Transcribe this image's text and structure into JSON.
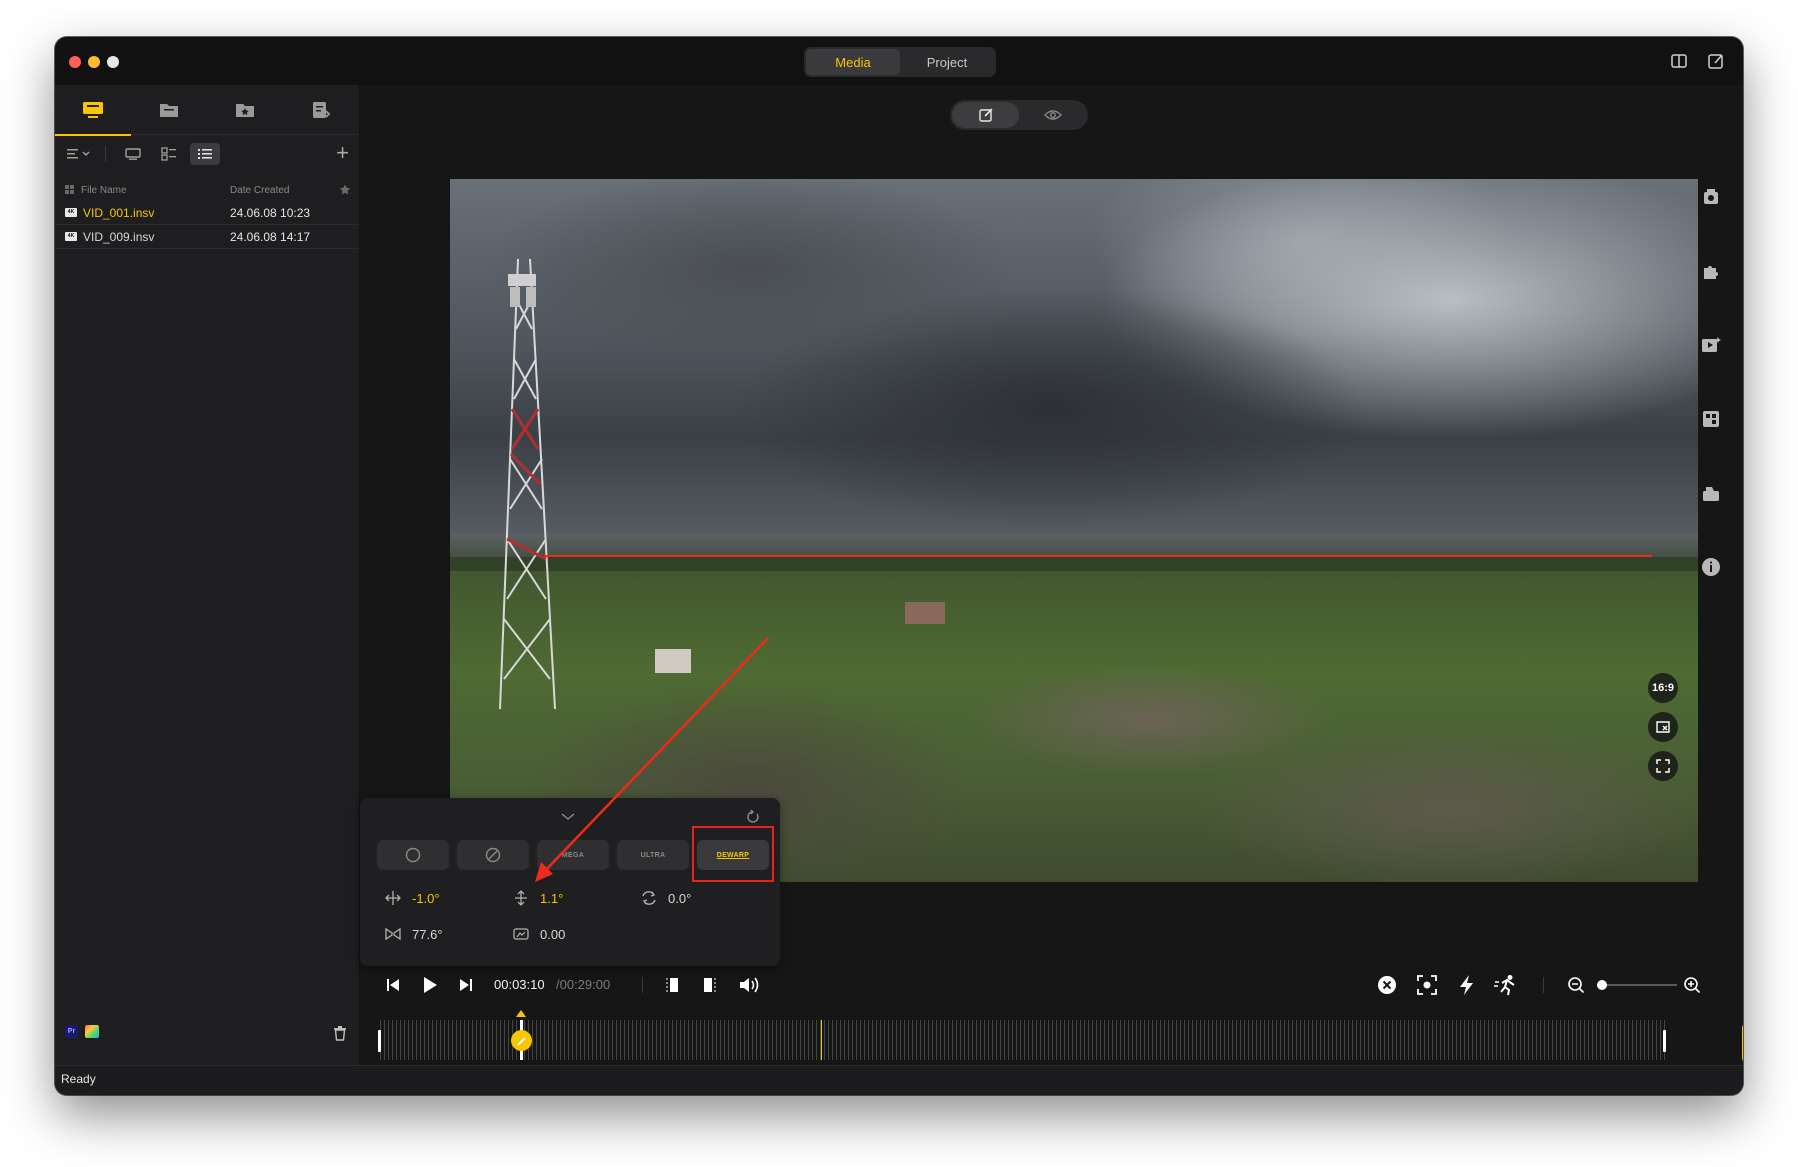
{
  "titlebar": {
    "tabs": [
      {
        "label": "Media",
        "active": true
      },
      {
        "label": "Project",
        "active": false
      }
    ]
  },
  "sidebar": {
    "tabs": [
      "monitor-icon",
      "folder-icon",
      "star-folder-icon",
      "export-list-icon"
    ],
    "file_list": {
      "headers": {
        "name": "File Name",
        "date": "Date Created"
      },
      "rows": [
        {
          "badge": "4K",
          "name": "VID_001.insv",
          "date": "24.06.08 10:23",
          "selected": true
        },
        {
          "badge": "4K",
          "name": "VID_009.insv",
          "date": "24.06.08 14:17",
          "selected": false
        }
      ]
    }
  },
  "viewer": {
    "aspect_ratio": "16:9"
  },
  "dewarp_panel": {
    "lens_modes": [
      {
        "label": "",
        "icon": "circle-lens-icon"
      },
      {
        "label": "",
        "icon": "tilted-lens-icon"
      },
      {
        "label": "MEGA",
        "icon": "mega-lens-icon"
      },
      {
        "label": "ULTRA",
        "icon": "ultra-lens-icon"
      },
      {
        "label": "DEWARP",
        "icon": "dewarp-lens-icon",
        "active": true
      }
    ],
    "params": {
      "pan": "-1.0°",
      "tilt": "1.1°",
      "roll": "0.0°",
      "fov": "77.6°",
      "distortion": "0.00"
    }
  },
  "transport": {
    "current_time": "00:03:10",
    "total_time": "/00:29:00"
  },
  "status": {
    "text": "Ready"
  },
  "colors": {
    "accent": "#f7c600",
    "annotation": "#e8231a"
  }
}
